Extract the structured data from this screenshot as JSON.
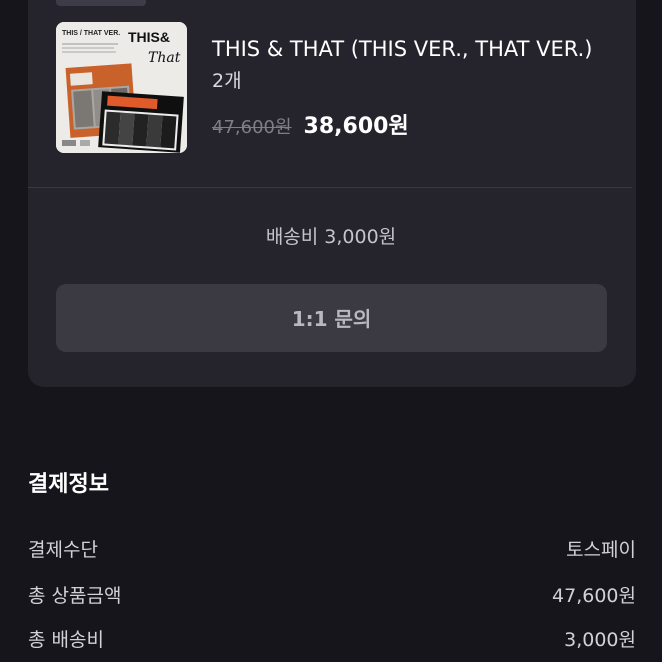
{
  "product": {
    "title": "THIS & THAT (THIS VER., THAT VER.)",
    "quantity": "2개",
    "original_price": "47,600원",
    "sale_price": "38,600원",
    "image_alt": "THIS & THAT album cover",
    "cover_text_top": "THIS / THAT VER.",
    "cover_text_big": "THIS&",
    "cover_text_script": "That"
  },
  "order": {
    "shipping_fee": "배송비 3,000원",
    "inquiry_button": "1:1 문의"
  },
  "payment": {
    "title": "결제정보",
    "rows": [
      {
        "label": "결제수단",
        "value": "토스페이"
      },
      {
        "label": "총 상품금액",
        "value": "47,600원"
      },
      {
        "label": "총 배송비",
        "value": "3,000원"
      }
    ]
  },
  "colors": {
    "background": "#16151c",
    "card": "#25242c",
    "button": "#3b3a43"
  }
}
